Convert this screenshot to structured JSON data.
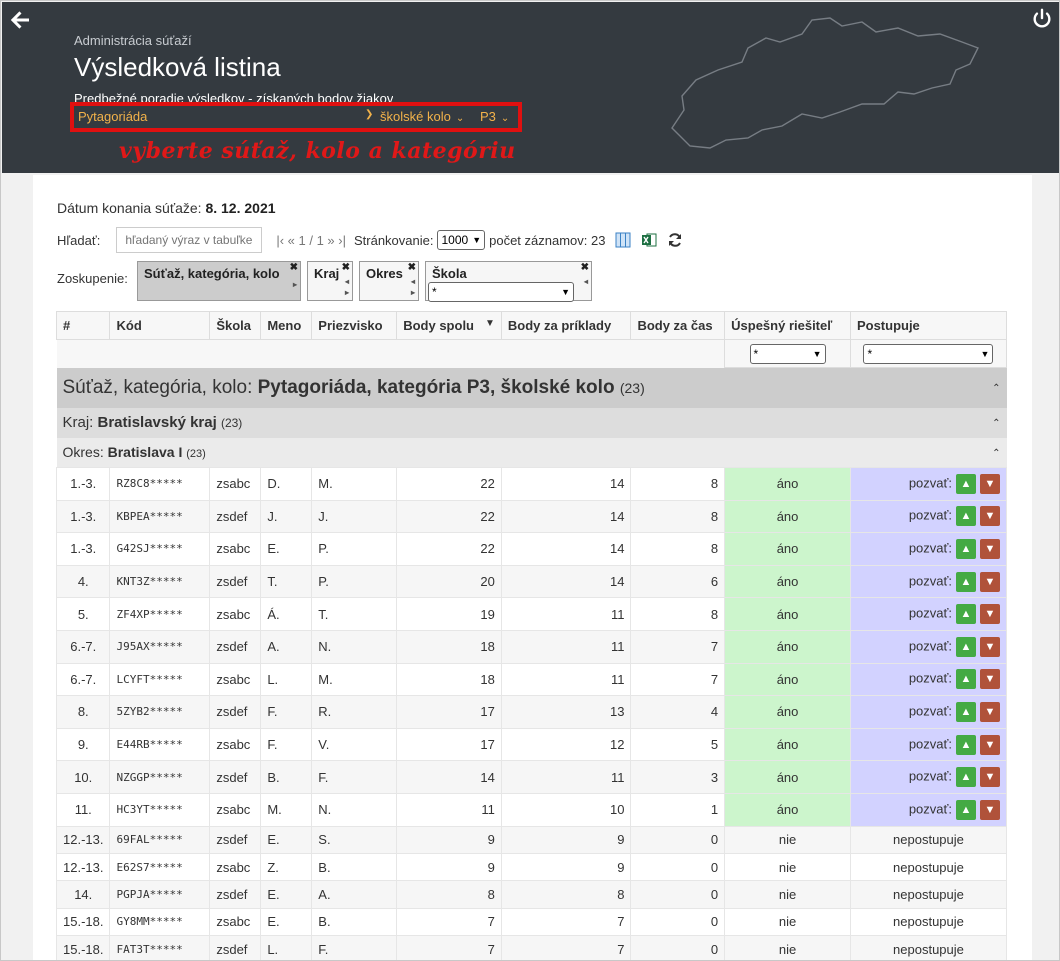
{
  "header": {
    "breadcrumb": "Administrácia súťaží",
    "title": "Výsledková listina",
    "subtitle": "Predbežné poradie výsledkov - získaných bodov žiakov",
    "selectors": {
      "competition": "Pytagoriáda",
      "round": "školské kolo",
      "category": "P3"
    },
    "hint": "vyberte súťaž, kolo a kategóriu",
    "accent_color": "#f2b24a",
    "highlight_color": "#e01010"
  },
  "toolbar": {
    "date_label": "Dátum konania súťaže:",
    "date_value": "8. 12. 2021",
    "search_label": "Hľadať:",
    "search_placeholder": "hľadaný výraz v tabuľke",
    "pager": "|‹ « 1 / 1 » ›|",
    "paging_label": "Stránkovanie:",
    "paging_value": "1000",
    "count_label": "počet záznamov: 23"
  },
  "grouping": {
    "label": "Zoskupenie:",
    "chips": [
      "Súťaž, kategória, kolo",
      "Kraj",
      "Okres",
      "Škola"
    ],
    "school_filter": "*"
  },
  "table": {
    "columns": [
      "#",
      "Kód",
      "Škola",
      "Meno",
      "Priezvisko",
      "Body spolu",
      "Body za príklady",
      "Body za čas",
      "Úspešný riešiteľ",
      "Postupuje"
    ],
    "filter_value": "*",
    "group1_prefix": "Súťaž, kategória, kolo:",
    "group1_name": "Pytagoriáda, kategória P3, školské kolo",
    "group1_count": "(23)",
    "group2_prefix": "Kraj:",
    "group2_name": "Bratislavský kraj",
    "group2_count": "(23)",
    "group3_prefix": "Okres:",
    "group3_name": "Bratislava I",
    "group3_count": "(23)",
    "invite_label": "pozvať:",
    "rows": [
      {
        "rank": "1.-3.",
        "code": "RZ8C8*****",
        "school": "zsabc",
        "name": "D.",
        "surname": "M.",
        "total": "22",
        "ex": "14",
        "time": "8",
        "ok": "áno",
        "adv": "invite"
      },
      {
        "rank": "1.-3.",
        "code": "KBPEA*****",
        "school": "zsdef",
        "name": "J.",
        "surname": "J.",
        "total": "22",
        "ex": "14",
        "time": "8",
        "ok": "áno",
        "adv": "invite"
      },
      {
        "rank": "1.-3.",
        "code": "G42SJ*****",
        "school": "zsabc",
        "name": "E.",
        "surname": "P.",
        "total": "22",
        "ex": "14",
        "time": "8",
        "ok": "áno",
        "adv": "invite"
      },
      {
        "rank": "4.",
        "code": "KNT3Z*****",
        "school": "zsdef",
        "name": "T.",
        "surname": "P.",
        "total": "20",
        "ex": "14",
        "time": "6",
        "ok": "áno",
        "adv": "invite"
      },
      {
        "rank": "5.",
        "code": "ZF4XP*****",
        "school": "zsabc",
        "name": "Á.",
        "surname": "T.",
        "total": "19",
        "ex": "11",
        "time": "8",
        "ok": "áno",
        "adv": "invite"
      },
      {
        "rank": "6.-7.",
        "code": "J95AX*****",
        "school": "zsdef",
        "name": "A.",
        "surname": "N.",
        "total": "18",
        "ex": "11",
        "time": "7",
        "ok": "áno",
        "adv": "invite"
      },
      {
        "rank": "6.-7.",
        "code": "LCYFT*****",
        "school": "zsabc",
        "name": "L.",
        "surname": "M.",
        "total": "18",
        "ex": "11",
        "time": "7",
        "ok": "áno",
        "adv": "invite"
      },
      {
        "rank": "8.",
        "code": "5ZYB2*****",
        "school": "zsdef",
        "name": "F.",
        "surname": "R.",
        "total": "17",
        "ex": "13",
        "time": "4",
        "ok": "áno",
        "adv": "invite"
      },
      {
        "rank": "9.",
        "code": "E44RB*****",
        "school": "zsabc",
        "name": "F.",
        "surname": "V.",
        "total": "17",
        "ex": "12",
        "time": "5",
        "ok": "áno",
        "adv": "invite"
      },
      {
        "rank": "10.",
        "code": "NZGGP*****",
        "school": "zsdef",
        "name": "B.",
        "surname": "F.",
        "total": "14",
        "ex": "11",
        "time": "3",
        "ok": "áno",
        "adv": "invite"
      },
      {
        "rank": "11.",
        "code": "HC3YT*****",
        "school": "zsabc",
        "name": "M.",
        "surname": "N.",
        "total": "11",
        "ex": "10",
        "time": "1",
        "ok": "áno",
        "adv": "invite"
      },
      {
        "rank": "12.-13.",
        "code": "69FAL*****",
        "school": "zsdef",
        "name": "E.",
        "surname": "S.",
        "total": "9",
        "ex": "9",
        "time": "0",
        "ok": "nie",
        "adv": "nepostupuje"
      },
      {
        "rank": "12.-13.",
        "code": "E62S7*****",
        "school": "zsabc",
        "name": "Z.",
        "surname": "B.",
        "total": "9",
        "ex": "9",
        "time": "0",
        "ok": "nie",
        "adv": "nepostupuje"
      },
      {
        "rank": "14.",
        "code": "PGPJA*****",
        "school": "zsdef",
        "name": "E.",
        "surname": "A.",
        "total": "8",
        "ex": "8",
        "time": "0",
        "ok": "nie",
        "adv": "nepostupuje"
      },
      {
        "rank": "15.-18.",
        "code": "GY8MM*****",
        "school": "zsabc",
        "name": "E.",
        "surname": "B.",
        "total": "7",
        "ex": "7",
        "time": "0",
        "ok": "nie",
        "adv": "nepostupuje"
      },
      {
        "rank": "15.-18.",
        "code": "FAT3T*****",
        "school": "zsdef",
        "name": "L.",
        "surname": "F.",
        "total": "7",
        "ex": "7",
        "time": "0",
        "ok": "nie",
        "adv": "nepostupuje"
      }
    ]
  }
}
